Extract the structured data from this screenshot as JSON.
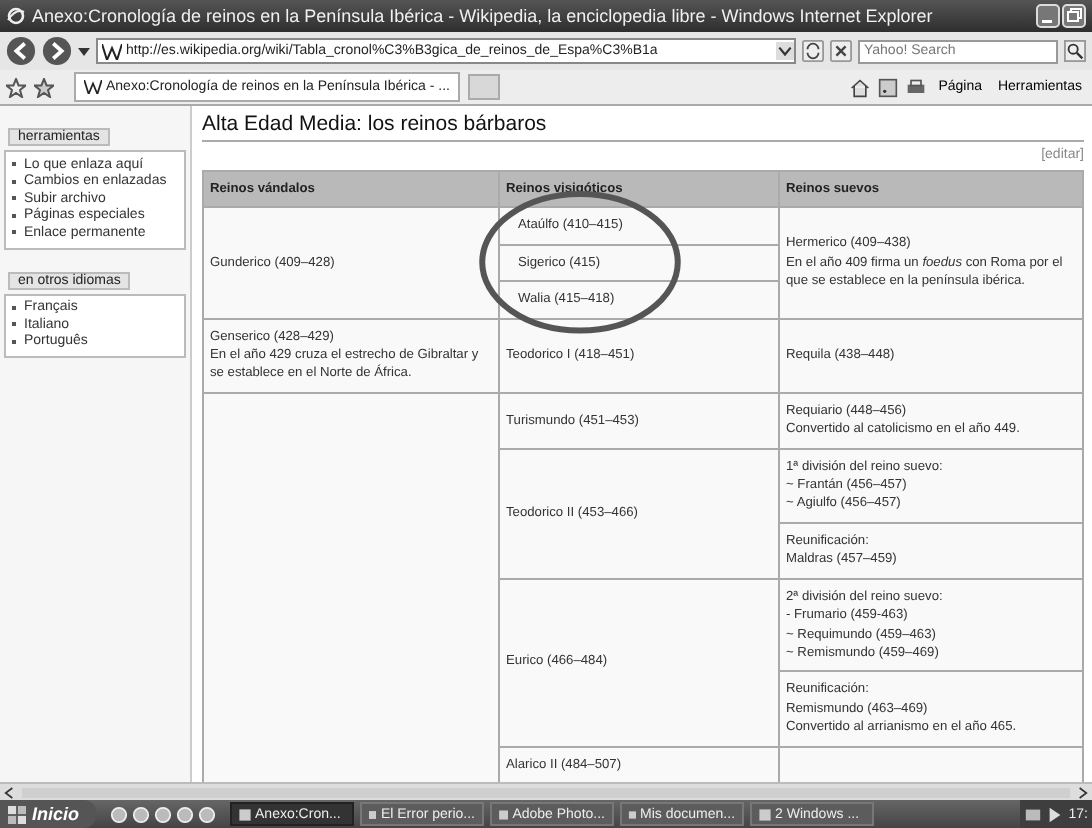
{
  "window": {
    "title": "Anexo:Cronología de reinos en la Península Ibérica - Wikipedia, la enciclopedia libre - Windows Internet Explorer"
  },
  "address_bar": {
    "url": "http://es.wikipedia.org/wiki/Tabla_cronol%C3%B3gica_de_reinos_de_Espa%C3%B1a"
  },
  "search": {
    "placeholder": "Yahoo! Search"
  },
  "tabs": [
    {
      "label": "Anexo:Cronología de reinos en la Península Ibérica - ...",
      "selected": true
    }
  ],
  "command_bar": {
    "menus": [
      "Página",
      "Herramientas"
    ]
  },
  "sidebar": {
    "portlets": [
      {
        "title": "herramientas",
        "items": [
          "Lo que enlaza aquí",
          "Cambios en enlazadas",
          "Subir archivo",
          "Páginas especiales",
          "Enlace permanente"
        ]
      },
      {
        "title": "en otros idiomas",
        "items": [
          "Français",
          "Italiano",
          "Português"
        ]
      }
    ]
  },
  "article": {
    "heading": "Alta Edad Media: los reinos bárbaros",
    "edit_link": "[editar]",
    "table": {
      "columns": [
        "Reinos vándalos",
        "Reinos visigóticos",
        "Reinos suevos"
      ],
      "groups": [
        {
          "vandal": {
            "lines": [
              "Gunderico (409–428)"
            ]
          },
          "subgroups": [
            {
              "visigoth": [
                {
                  "lines": [
                    "Ataúlfo (410–415)"
                  ]
                },
                {
                  "lines": [
                    "Sigerico (415)"
                  ]
                },
                {
                  "lines": [
                    "Walia (415–418)"
                  ]
                }
              ],
              "suevo": [
                {
                  "lines": [
                    "Hermerico (409–438)",
                    "En el año 409 firma un *foedus* con Roma por el que se establece en la península ibérica."
                  ]
                }
              ]
            }
          ]
        },
        {
          "vandal": {
            "lines": [
              "Genserico (428–429)",
              "En el año 429 cruza el estrecho de Gibraltar y se establece en el Norte de África."
            ]
          },
          "subgroups": [
            {
              "visigoth": [
                {
                  "lines": [
                    "Teodorico I (418–451)"
                  ]
                }
              ],
              "suevo": [
                {
                  "lines": [
                    "Requila (438–448)"
                  ]
                }
              ]
            }
          ]
        },
        {
          "subgroups": [
            {
              "visigoth": [
                {
                  "lines": [
                    "Turismundo (451–453)"
                  ]
                }
              ],
              "suevo": [
                {
                  "lines": [
                    "Requiario (448–456)",
                    "Convertido al catolicismo en el año 449."
                  ]
                }
              ]
            },
            {
              "visigoth": [
                {
                  "lines": [
                    "Teodorico II (453–466)"
                  ]
                }
              ],
              "suevo": [
                {
                  "lines": [
                    "1ª división del reino suevo:",
                    "~ Frantán (456–457)",
                    "~ Agiulfo (456–457)"
                  ]
                },
                {
                  "lines": [
                    "Reunificación:",
                    "Maldras (457–459)"
                  ]
                }
              ]
            },
            {
              "visigoth": [
                {
                  "lines": [
                    "Eurico (466–484)"
                  ]
                }
              ],
              "suevo": [
                {
                  "lines": [
                    "2ª división del reino suevo:",
                    "- Frumario (459-463)",
                    "~ Requimundo (459–463)",
                    "~ Remismundo (459–469)"
                  ]
                },
                {
                  "lines": [
                    "Reunificación:",
                    "Remismundo (463–469)",
                    "Convertido al arrianismo en el año 465."
                  ]
                }
              ]
            },
            {
              "visigoth": [
                {
                  "lines": [
                    "Alarico II (484–507)"
                  ]
                }
              ]
            }
          ]
        }
      ]
    }
  },
  "taskbar": {
    "start": "Inicio",
    "tasks": [
      {
        "label": "Anexo:Cron...",
        "selected": true
      },
      {
        "label": "El Error perio...",
        "selected": false
      },
      {
        "label": "Adobe Photo...",
        "selected": false
      },
      {
        "label": "Mis documen...",
        "selected": false
      },
      {
        "label": "2 Windows ...",
        "selected": false
      }
    ],
    "clock": "17:"
  }
}
